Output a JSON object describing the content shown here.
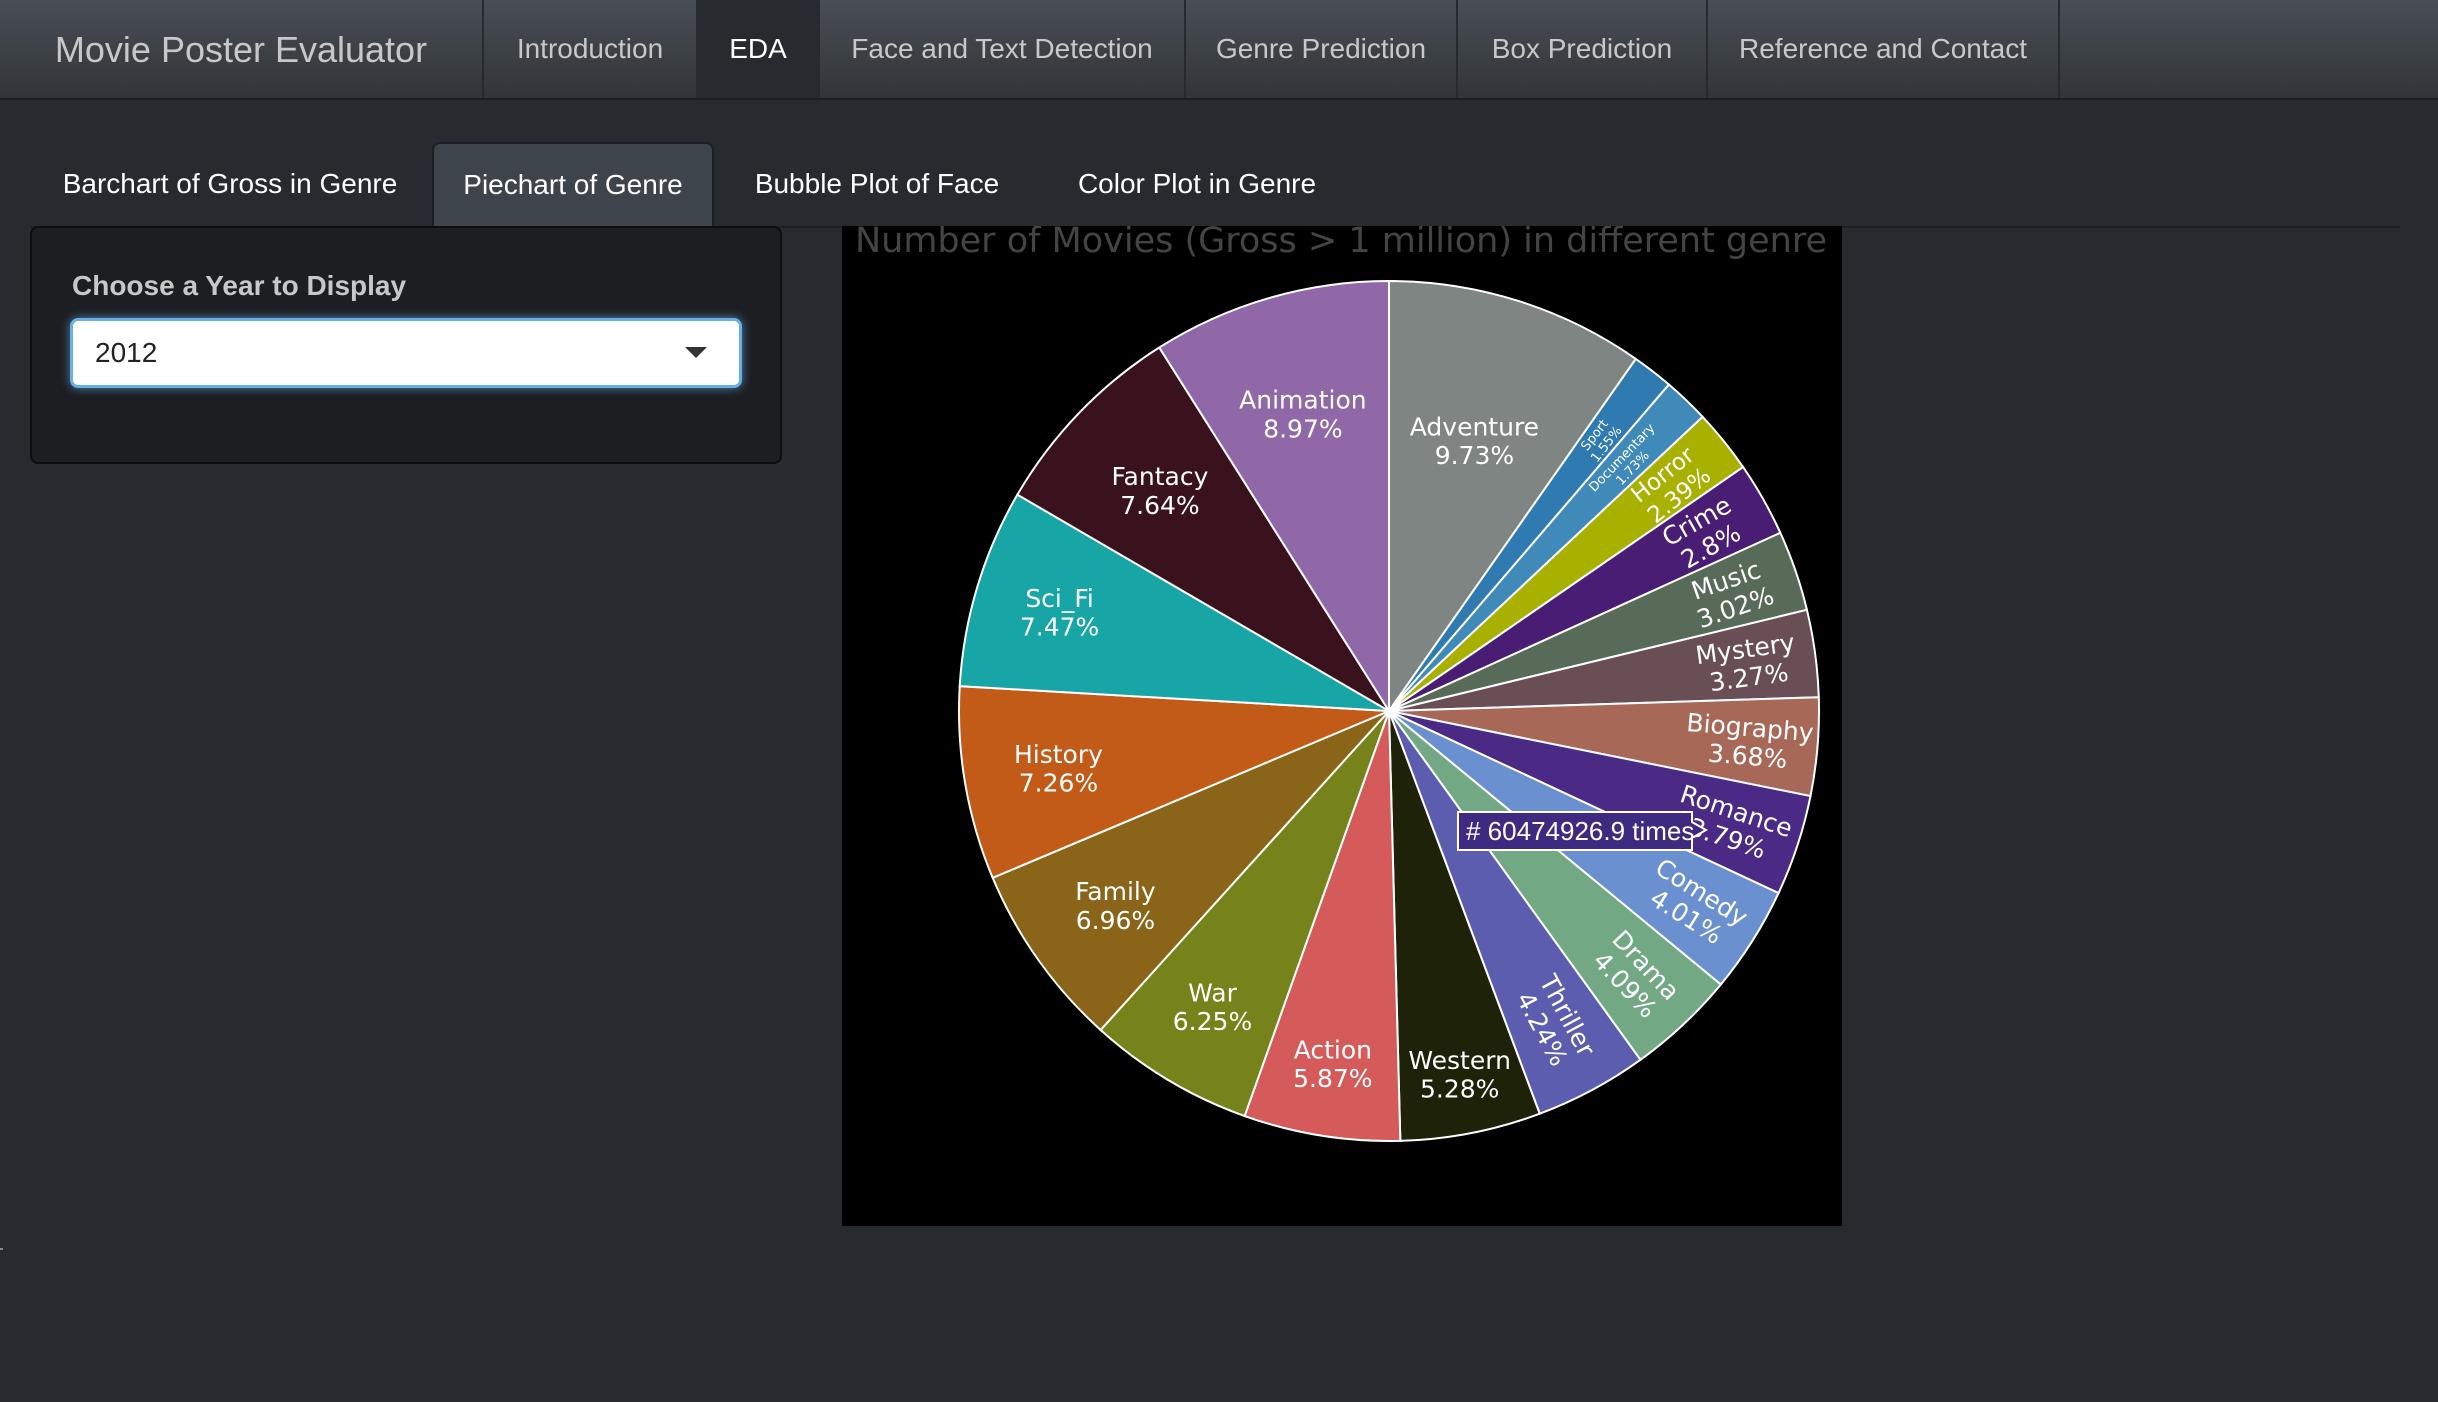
{
  "navbar": {
    "brand": "Movie Poster Evaluator",
    "tabs": [
      {
        "label": "Introduction"
      },
      {
        "label": "EDA"
      },
      {
        "label": "Face and Text Detection"
      },
      {
        "label": "Genre Prediction"
      },
      {
        "label": "Box Prediction"
      },
      {
        "label": "Reference and Contact"
      }
    ],
    "active_tab": "EDA"
  },
  "subtabs": {
    "tabs": [
      {
        "label": "Barchart of Gross in Genre"
      },
      {
        "label": "Piechart of Genre"
      },
      {
        "label": "Bubble Plot of Face"
      },
      {
        "label": "Color Plot in Genre"
      }
    ],
    "active_tab": "Piechart of Genre"
  },
  "sidebar": {
    "label": "Choose a Year to Display",
    "selected_year": "2012"
  },
  "chart_data": {
    "type": "pie",
    "title": "Number of Movies (Gross > 1 million) in different genre",
    "direction": "clockwise",
    "start": "12 o'clock",
    "background": "#000000",
    "slices": [
      {
        "label": "Adventure",
        "value": 9.73,
        "text": "9.73%",
        "color": "#7f8582"
      },
      {
        "label": "Sport",
        "value": 1.55,
        "text": "1.55%",
        "color": "#2f7ab0"
      },
      {
        "label": "Documentary",
        "value": 1.73,
        "text": "1.73%",
        "color": "#3f8ab8"
      },
      {
        "label": "Horror",
        "value": 2.39,
        "text": "2.39%",
        "color": "#a8b000"
      },
      {
        "label": "Crime",
        "value": 2.8,
        "text": "2.8%",
        "color": "#4a1d75"
      },
      {
        "label": "Music",
        "value": 3.02,
        "text": "3.02%",
        "color": "#586a58"
      },
      {
        "label": "Mystery",
        "value": 3.27,
        "text": "3.27%",
        "color": "#6a4e55"
      },
      {
        "label": "Biography",
        "value": 3.68,
        "text": "3.68%",
        "color": "#a86858"
      },
      {
        "label": "Romance",
        "value": 3.79,
        "text": "3.79%",
        "color": "#4b2a85"
      },
      {
        "label": "Comedy",
        "value": 4.01,
        "text": "4.01%",
        "color": "#6a90d0"
      },
      {
        "label": "Drama",
        "value": 4.09,
        "text": "4.09%",
        "color": "#72a884"
      },
      {
        "label": "Thriller",
        "value": 4.24,
        "text": "4.24%",
        "color": "#5d5db0"
      },
      {
        "label": "Western",
        "value": 5.28,
        "text": "5.28%",
        "color": "#1e2208"
      },
      {
        "label": "Action",
        "value": 5.87,
        "text": "5.87%",
        "color": "#d55a5a"
      },
      {
        "label": "War",
        "value": 6.25,
        "text": "6.25%",
        "color": "#76821a"
      },
      {
        "label": "Family",
        "value": 6.96,
        "text": "6.96%",
        "color": "#8a6418"
      },
      {
        "label": "History",
        "value": 7.26,
        "text": "7.26%",
        "color": "#c25a18"
      },
      {
        "label": "Sci_Fi",
        "value": 7.47,
        "text": "7.47%",
        "color": "#18a5a5"
      },
      {
        "label": "Fantacy",
        "value": 7.64,
        "text": "7.64%",
        "color": "#3a121e"
      },
      {
        "label": "Animation",
        "value": 8.97,
        "text": "8.97%",
        "color": "#9068a8"
      }
    ],
    "tooltip": {
      "text": "# 60474926.9 times",
      "slice": "Romance"
    }
  }
}
